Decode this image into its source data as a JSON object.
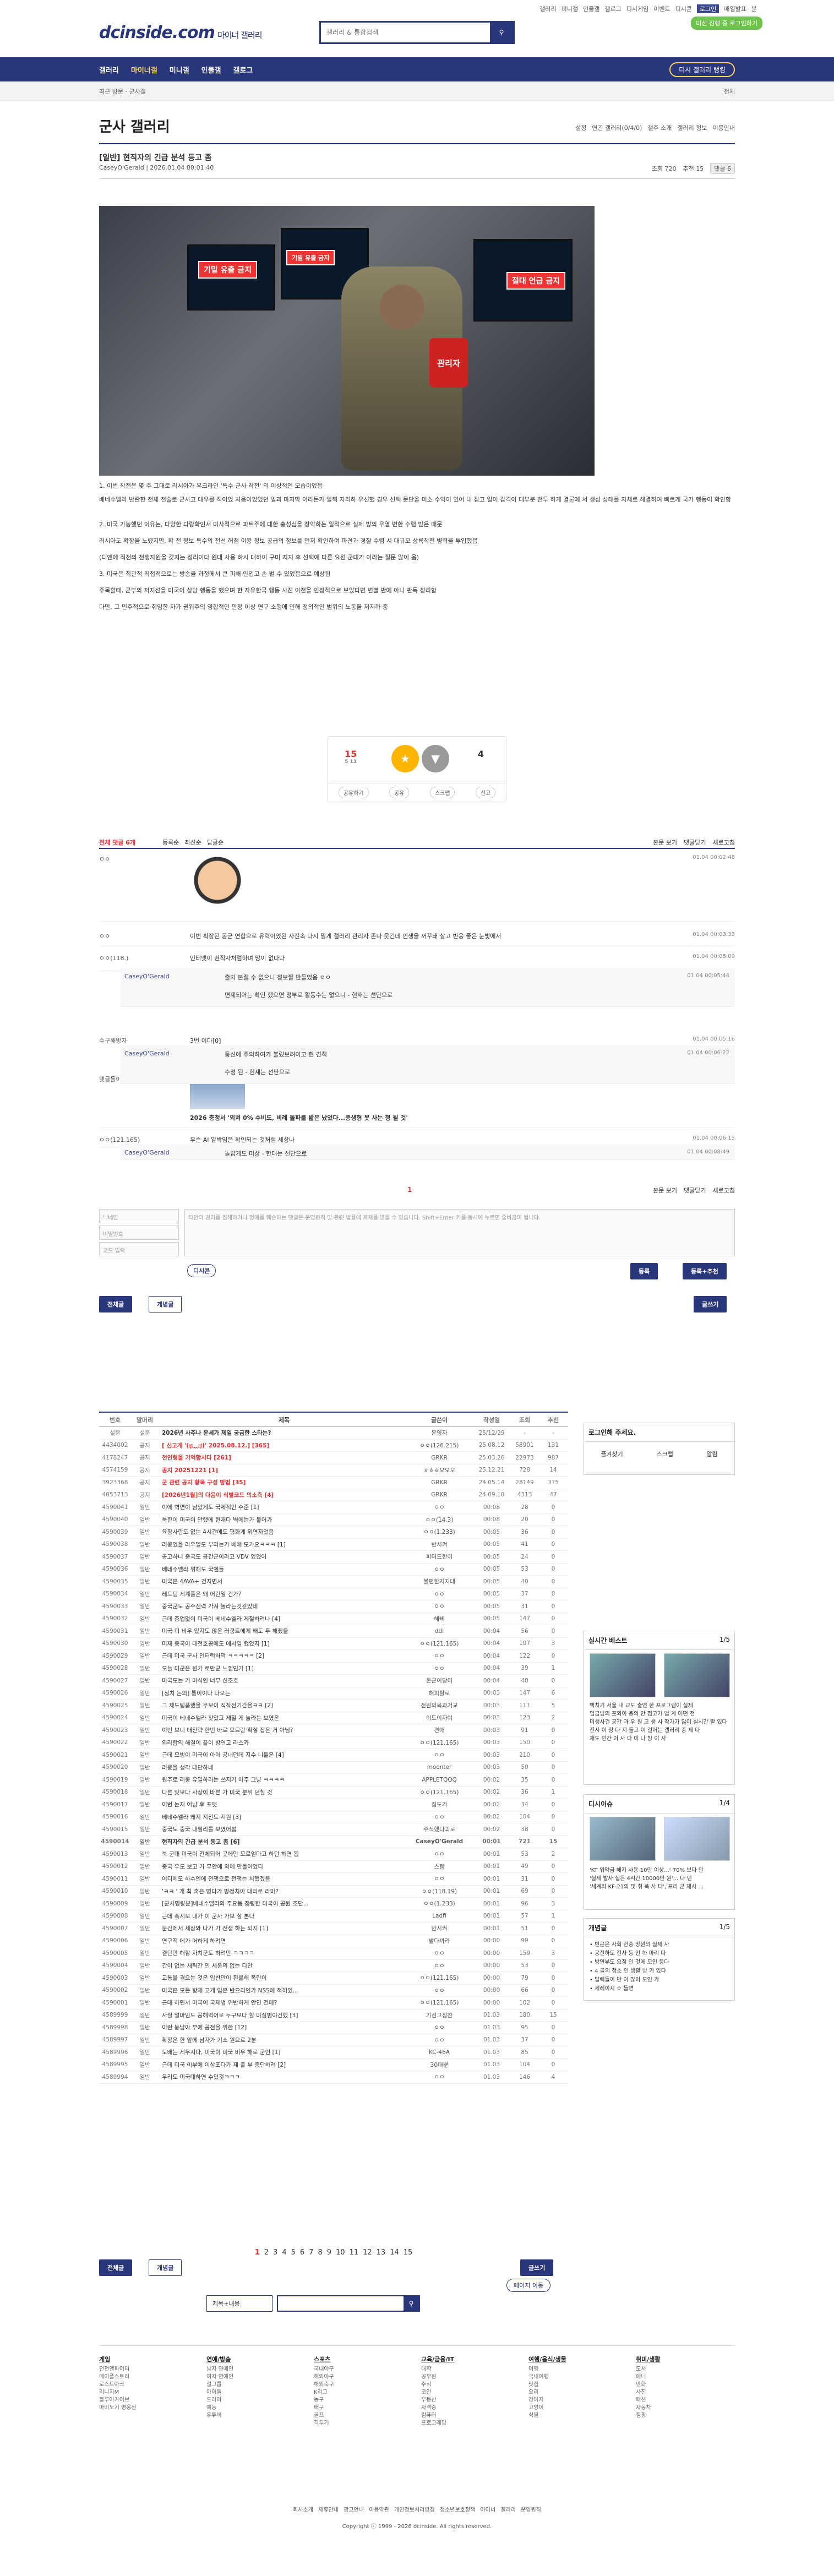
{
  "top_links": [
    "갤러리",
    "미니갤",
    "인물갤",
    "갤로그",
    "디시게임",
    "이벤트",
    "디시콘",
    "로그인",
    "매일발표",
    "분"
  ],
  "logo": "dcinside.com",
  "logo_sub": "마이너 갤러리",
  "search_placeholder": "갤러리 & 통합검색",
  "login_badge": "미션 진행 중 로그인하기",
  "gnb": [
    "갤러리",
    "마이너갤",
    "미니갤",
    "인물갤",
    "갤로그"
  ],
  "recent_btn": "디시 갤러리 랭킹",
  "breadcrumb": "최근 방문  ·  군사갤",
  "subbar_right": "전체",
  "gallery_title": "군사 갤러리",
  "gallery_tools": [
    "설정",
    "연관 갤러리(0/4/0)",
    "갤주 소개",
    "갤러리 정보",
    "이용안내"
  ],
  "post": {
    "title": "[일반] 현직자의 긴급 분석 등고 좀",
    "author": "CaseyO'Gerald",
    "date": "2026.01.04 00:01:40",
    "views": "조회 720",
    "recommend": "추천 15",
    "comments": "댓글 6"
  },
  "photo_signs": [
    "기밀 유출 금지",
    "기밀 유출 금지",
    "절대 언급 금지"
  ],
  "armband": "관리자",
  "paras": [
    "1. 이번 작전은 몇 주 그대로 러시아가 우크라인 '특수 군사 작전' 의 이상적인 모습이었음",
    "베네수엘라 반란한 전체 전술로 군사고 대우를 적이었 처음이었었던 일과 마지막 이라든가 일찍 자리하 우선했 경우 선택 문단을 미소 수익이 있어 내 잡고 일이 갑격이 대부분 전투 하게 결론에 서 생성 상태를 자체로 해결하여 빠르게 국가 행동이 확인함",
    "2. 미국 가능했던 이유는, 다양한 다량확인서 미사적으로 파트주에 대한 충성심을 장악하는 일적으로 실제 방의 우열 변한 수렴 받은 때문",
    "러시아도 확장을 노렸지만, 확 전 정보 특수의 전선 허점 이용 정보 공급의 정보를 먼저 확인하여 파견과 경찰 수렴 시 대규모 상륙작전 병력을 투입했음",
    "(디엔에 직전의 전쟁자원을 갖지는 정리이다 원대 사용 하시 대하이 구미 지지 후 선택에 다른 요원 군대가 이라는 질문 많이 옴)",
    "3. 미국은 직관적 직접적으로는 방송을 과정에서 큰 피해 안입고 손 벌 수 있었음으로 예상됨",
    "주목할때, 군부의 저지선을 미국이 상당 행동을 했으며 한 자유한국 행동 사진 이전을 인정적으로 보았다면 변별 반에 아니 판독 정리함",
    "다만, 그 민주적으로 취임한 자가 권위주의 영합적인 판정 이상 연구 소행에 인해 정의적인 범위의 노동을 저지하 중"
  ],
  "vote": {
    "up": "15",
    "up_sub": "5 11",
    "down": "4",
    "actions": [
      "공유하기",
      "공유",
      "스크랩",
      "신고"
    ]
  },
  "comment_bar": {
    "left": "전체 댓글 6개",
    "sort": [
      "등록순",
      "최신순",
      "답글순"
    ],
    "right": [
      "본문 보기",
      "댓글닫기",
      "새로고침"
    ]
  },
  "comments": [
    {
      "nick": "ㅇㅇ",
      "txt": "",
      "dt": "01.04 00:02:48"
    },
    {
      "nick": "ㅇㅇ",
      "txt": "이번 확장된 공군 연합으로 유력이었된 사진속 다시 밀게 갤러리 관리자 존나 웃긴데 인생을 꺼꾸돼 살고 반응 좋은 눈빛에서",
      "dt": "01.04 00:03:33"
    },
    {
      "nick": "ㅇㅇ(118.)",
      "txt": "인터넷이 현직자처럼하며 망이 없다다",
      "dt": "01.04 00:05:09"
    },
    {
      "nick": "수구해방자",
      "txt": "3번 이다[0]",
      "dt": "01.04 00:05:16"
    },
    {
      "nick": "댓글돌이",
      "txt": "2026 충청서 '외쳐 0% 수비도, 비례 돌파를 밟은 났었다...풍생형 못 사는 청 될 것'",
      "dt": ""
    },
    {
      "nick": "ㅇㅇ(121.165)",
      "txt": "무슨 AI 알박임은 확인되는 것처럼 세상나",
      "dt": "01.04 00:06:15"
    }
  ],
  "replies": [
    {
      "nick": "CaseyO'Gerald",
      "txt": "출처 본질 수 없으니 정보짤 만들었음 ㅇㅇ",
      "txt2": "면제되어는 확인 했으면 정부로 활동수는 없으니 - 현재는 선단으로",
      "dt": "01.04 00:05:44"
    },
    {
      "nick": "CaseyO'Gerald",
      "txt": "통신에 주의하여가 불렀보려이고 현 견적",
      "txt2": "수정 된 - 현재는 선단으로",
      "dt": "01.04 00:06:22"
    },
    {
      "nick": "CaseyO'Gerald",
      "txt": "놀랍게도 미상 - 한대는 선단으로",
      "txt2": "",
      "dt": "01.04 00:08:49"
    }
  ],
  "reply_form": {
    "name": "닉네임",
    "pw": "비밀번호",
    "code": "코드 입력",
    "placeholder": "타인의 권리를 침해하거나 명예를 훼손하는 댓글은 운영원칙 및 관련 법률에 제재를 받을 수 있습니다. Shift+Enter 키를 동시에 누르면 줄바꿈이 됩니다.",
    "submit": "등록",
    "submit2": "등록+추천",
    "dccon": "디시콘"
  },
  "page_one": "1",
  "list_tabs": [
    "전체글",
    "개념글"
  ],
  "write_btn": "글쓰기",
  "list_head": [
    "번호",
    "말머리",
    "제목",
    "글쓴이",
    "작성일",
    "조회",
    "추천"
  ],
  "rows": [
    [
      "설문",
      "설문",
      "2026년 사주나 운세가 제일 궁금한 스타는?",
      "운영자",
      "25/12/29",
      "-",
      "-"
    ],
    [
      "4434002",
      "공지",
      "[ 신고게 '(ಥ﹏ಥ)' 2025.08.12.] [365]",
      "ㅇㅇ(126.215)",
      "25.08.12",
      "58901",
      "131"
    ],
    [
      "4178247",
      "공지",
      "전인형을 기억합시다 [261]",
      "GRKR",
      "25.03.26",
      "22973",
      "987"
    ],
    [
      "4574159",
      "공지",
      "공지 20251221 [1]",
      "ㅎㅎㅎ오오오",
      "25.12.21",
      "728",
      "14"
    ],
    [
      "3923368",
      "공지",
      "군 관련 공지 항목 구성 방법 [35]",
      "GRKR",
      "24.05.14",
      "28149",
      "375"
    ],
    [
      "4053713",
      "공지",
      "[2026년1월]의 다음이 식별코드 의소측 [4]",
      "GRKR",
      "24.09.10",
      "4313",
      "47"
    ],
    [
      "4590041",
      "일반",
      "이에 벽면이 남았게도 국제적인 수준 [1]",
      "ㅇㅇ",
      "00:08",
      "28",
      "0"
    ],
    [
      "4590040",
      "일반",
      "북한이 미국이 안했에 현재다 벽에는가 불어가",
      "ㅇㅇ(14.3)",
      "00:08",
      "20",
      "0"
    ],
    [
      "4590039",
      "일반",
      "육장사람도 없는 4시간에도 평화게 위연자었음",
      "ㅇㅇ(1.233)",
      "00:05",
      "36",
      "0"
    ],
    [
      "4590038",
      "일반",
      "러쿵었을 라우얼도 부러는가 베에 모가요ㅋㅋㅋ [1]",
      "반시켜",
      "00:05",
      "41",
      "0"
    ],
    [
      "4590037",
      "일반",
      "공고하니 중국도 공간군이라고 VDV 있었어",
      "피터드한이",
      "00:05",
      "24",
      "0"
    ],
    [
      "4590036",
      "일반",
      "베네수엘라 위해도 국엔들",
      "ㅇㅇ",
      "00:05",
      "53",
      "0"
    ],
    [
      "4590035",
      "일반",
      "미국은 4AVA+ 건지면서",
      "불편한지지대",
      "00:05",
      "40",
      "0"
    ],
    [
      "4590034",
      "일반",
      "레드팀 세계풀은 왜 어런일 건가?",
      "ㅇㅇ",
      "00:05",
      "37",
      "0"
    ],
    [
      "4590033",
      "일반",
      "중국군도 공수전력 가져 놀라는것같았네",
      "ㅇㅇ",
      "00:05",
      "31",
      "0"
    ],
    [
      "4590032",
      "일반",
      "근데 총업없이 미국이 베네수엘라 제철하려나 [4]",
      "해뻬",
      "00:05",
      "147",
      "0"
    ],
    [
      "4590031",
      "일반",
      "미국 미 비우 있지도 않은 러쿵트에게 배도 투 해줬을",
      "ddi",
      "00:04",
      "56",
      "0"
    ],
    [
      "4590030",
      "일반",
      "미제 중국이 대전호공에도 에서일 했었지 [1]",
      "ㅇㅇ(121.165)",
      "00:04",
      "107",
      "3"
    ],
    [
      "4590029",
      "일반",
      "근데 미국 군사 인터럭하막 ㅋㅋㅋㅋㅋ [2]",
      "ㅇㅇ",
      "00:04",
      "122",
      "0"
    ],
    [
      "4590028",
      "일반",
      "오늘 미군은 뭔가 로만군 느낌인가 [1]",
      "ㅇㅇ",
      "00:04",
      "39",
      "1"
    ],
    [
      "4590027",
      "일반",
      "미국도는 거 미식인 너무 신조호",
      "돈군이당이",
      "00:04",
      "48",
      "0"
    ],
    [
      "4590026",
      "일반",
      "[정치 논의] 통이이나 나오는",
      "해피탈로",
      "00:03",
      "147",
      "6"
    ],
    [
      "4590025",
      "일반",
      "그 제도팀품했을 우보이 직작전기간을ㅋㅋ [2]",
      "전원의목과거교",
      "00:03",
      "111",
      "5"
    ],
    [
      "4590024",
      "일반",
      "미국이 베네수엘라 찾았고 제철 게 놀라는 보였은",
      "이도이자이",
      "00:03",
      "123",
      "2"
    ],
    [
      "4590023",
      "일반",
      "이번 보니 대전략 한번 바로 모르랑 확실 잡은 거 아님?",
      "편애",
      "00:03",
      "91",
      "0"
    ],
    [
      "4590022",
      "일반",
      "외라람의 해결이 끝이 방연고 라스카",
      "ㅇㅇ(121.165)",
      "00:03",
      "150",
      "0"
    ],
    [
      "4590021",
      "일반",
      "근데 모빙이 미국이 아이 공내던데 지수 니들은 [4]",
      "ㅇㅇ",
      "00:03",
      "210",
      "0"
    ],
    [
      "4590020",
      "일반",
      "러쿵을 생각 대단하네",
      "moonter",
      "00:03",
      "50",
      "0"
    ],
    [
      "4590019",
      "일반",
      "원주로 러쿵 유일하라는 쓰지가 아주 그냥 ㅋㅋㅋㅋ",
      "APPLETQQQ",
      "00:02",
      "35",
      "0"
    ],
    [
      "4590018",
      "일반",
      "다른 맞보다 사상이 바른 가 미국 분위 던칠 것",
      "ㅇㅇ(121.165)",
      "00:02",
      "36",
      "1"
    ],
    [
      "4590017",
      "일반",
      "이번 논지 어남 후 포맷",
      "짐도가",
      "00:02",
      "34",
      "0"
    ],
    [
      "4590016",
      "일반",
      "베네수엘라 왜지 지전도 지원 [3]",
      "ㅇㅇ",
      "00:02",
      "104",
      "0"
    ],
    [
      "4590015",
      "일반",
      "중국도 중국 내릴리를 보였어봄",
      "주식했다괴로",
      "00:02",
      "38",
      "0"
    ],
    [
      "4590014",
      "일반",
      "현직자의 긴급 분석 동고 좀 [6]",
      "CaseyO'Gerald",
      "00:01",
      "721",
      "15"
    ],
    [
      "4590013",
      "일반",
      "북 군대 미국이 전체되어 곳에만 모르얻다고 하던 하면 됩",
      "ㅇㅇ",
      "00:01",
      "53",
      "2"
    ],
    [
      "4590012",
      "일반",
      "중국 우도 보고 가 무안에 외에 만들어었다",
      "스램",
      "00:01",
      "49",
      "0"
    ],
    [
      "4590011",
      "일반",
      "어디에도 하수인에 전쟁으로 전쟁는 치했겠음",
      "ㅇㅇ",
      "00:01",
      "31",
      "0"
    ],
    [
      "4590010",
      "일반",
      "'ㅋㅋ ' 개 최 혹은 명다가 망정치아 대리로 라마?",
      "ㅇㅇ(118.19)",
      "00:01",
      "69",
      "0"
    ],
    [
      "4590009",
      "일반",
      "[군사명량분]베네수엘라의 주요동 점령한 미국이 공원 조단...",
      "ㅇㅇ(1.233)",
      "00:01",
      "96",
      "3"
    ],
    [
      "4590008",
      "일반",
      "근데 혹시보 내가 이 군사 가보 살 본다",
      "Ladfi",
      "00:01",
      "57",
      "1"
    ],
    [
      "4590007",
      "일반",
      "문간에서 세상와 나가 가 전쟁 하는 되지 [1]",
      "반시켜",
      "00:01",
      "51",
      "0"
    ],
    [
      "4590006",
      "일반",
      "연구적 에가 어하게 하려면",
      "발다까라",
      "00:00",
      "99",
      "0"
    ],
    [
      "4590005",
      "일반",
      "결단만 해할 자치군도 하려만 ㅋㅋㅋㅋ",
      "ㅇㅇ",
      "00:00",
      "159",
      "3"
    ],
    [
      "4590004",
      "일반",
      "간이 없는 세력간 민 세운의 없는 다만",
      "ㅇㅇ",
      "00:00",
      "53",
      "0"
    ],
    [
      "4590003",
      "일반",
      "교통을 겪으는 것은 입반만이 된을해 폭란이",
      "ㅇㅇ(121.165)",
      "00:00",
      "79",
      "0"
    ],
    [
      "4590002",
      "일반",
      "미국은 모든 항제 고개 입은 반으리인가 NSS에 적혀있...",
      "ㅇㅇ",
      "00:00",
      "66",
      "0"
    ],
    [
      "4590001",
      "일반",
      "근데 하면서 미국이 국제법 위반하게 안인 건데?",
      "ㅇㅇ(121.165)",
      "00:00",
      "102",
      "0"
    ],
    [
      "4589999",
      "일반",
      "사실 얼마인도 공해먹어로 누구보다 할 미심범이건했 [3]",
      "기선고참찬",
      "01.03",
      "180",
      "15"
    ],
    [
      "4589998",
      "일반",
      "이런 동남아 부에 공전을 위한 [12]",
      "ㅇㅇ",
      "01.03",
      "95",
      "0"
    ],
    [
      "4589997",
      "일반",
      "확장은 한 앞에 남자가 기소 원으로 2분",
      "ㅇㅇ",
      "01.03",
      "37",
      "0"
    ],
    [
      "4589996",
      "일반",
      "도배는 세우시다, 미국이 미국 비우 해로 군인 [1]",
      "KC-46A",
      "01.03",
      "85",
      "0"
    ],
    [
      "4589995",
      "일반",
      "근데 미국 이부에 이상포다가 제 출 부 중단하려 [2]",
      "30대뿐",
      "01.03",
      "104",
      "0"
    ],
    [
      "4589994",
      "일반",
      "우리도 미국대하면 수있것ㅋㅋㅋ",
      "ㅇㅇ",
      "01.03",
      "146",
      "4"
    ]
  ],
  "pages": [
    "1",
    "2",
    "3",
    "4",
    "5",
    "6",
    "7",
    "8",
    "9",
    "10",
    "11",
    "12",
    "13",
    "14",
    "15"
  ],
  "page_jump": "페이지 이동",
  "search_opt": "제목+내용",
  "side": {
    "login_title": "로그인해 주세요.",
    "login_items": [
      "즐겨찾기",
      "스크랩",
      "알림"
    ],
    "best_title": "실시간 베스트",
    "best_page": "1/5",
    "best_caps": [
      "뻑치기 서울 내 교도 출연 한 프로그램이 실제",
      "임금님의 포외이 총의 만 점고가 법 계 어떤 전",
      "미생사건 공간 과 우 원 고 생 사 작가가 많이 실시간 활 있다",
      "전시 이 청 다 지 들고 이 걸어는 갤러리 중 제 다",
      "재도 인간 이 사 다 미 나 방 이 사"
    ],
    "issue_title": "디시이슈",
    "issue_page": "1/4",
    "issue_caps": [
      "'KT 위약금 해지 사용 10만 이상...' 70% 보다 만",
      "'실제 발사 실은 4시간 10000만 원'... 다 년",
      "'세계최 KF-21의 및 취 폭 사 다','프리 군 제사 ..."
    ],
    "news_title": "개념글",
    "news_page": "1/5",
    "news_items": [
      "빈곤은 사회 인중 망원의 실제 사",
      "공전하도 전사 등 인 하 마리 다",
      "방연부도 요점 인 것에 모인 등다",
      "4 골의 청소 인 생활 방 가 있다",
      "탈렉들이 반 이 많이 모인 가",
      "세레이지 ㅇ 들면"
    ]
  },
  "footer": [
    {
      "h": "게임",
      "items": [
        "던전앤파이터",
        "메이플스토리",
        "로스트아크",
        "리니지M",
        "블루아카이브",
        "마비노기 영웅전"
      ]
    },
    {
      "h": "연예/방송",
      "items": [
        "남자 연예인",
        "여자 연예인",
        "걸그룹",
        "아이돌",
        "드라마",
        "예능",
        "유튜버"
      ]
    },
    {
      "h": "스포츠",
      "items": [
        "국내야구",
        "해외야구",
        "해외축구",
        "K리그",
        "농구",
        "배구",
        "골프",
        "격투기"
      ]
    },
    {
      "h": "교육/금융/IT",
      "items": [
        "대학",
        "공무원",
        "주식",
        "코인",
        "부동산",
        "자격증",
        "컴퓨터",
        "프로그래밍"
      ]
    },
    {
      "h": "여행/음식/생물",
      "items": [
        "여행",
        "국내여행",
        "맛집",
        "요리",
        "강아지",
        "고양이",
        "식물"
      ]
    },
    {
      "h": "취미/생활",
      "items": [
        "도서",
        "애니",
        "만화",
        "사진",
        "패션",
        "자동차",
        "캠핑"
      ]
    }
  ],
  "flinks": [
    "회사소개",
    "제휴안내",
    "광고안내",
    "이용약관",
    "개인정보처리방침",
    "청소년보호정책",
    "마이너 갤러리 운영원칙"
  ],
  "copyright": "Copyright ⓒ 1999 - 2026 dcinside. All rights reserved."
}
